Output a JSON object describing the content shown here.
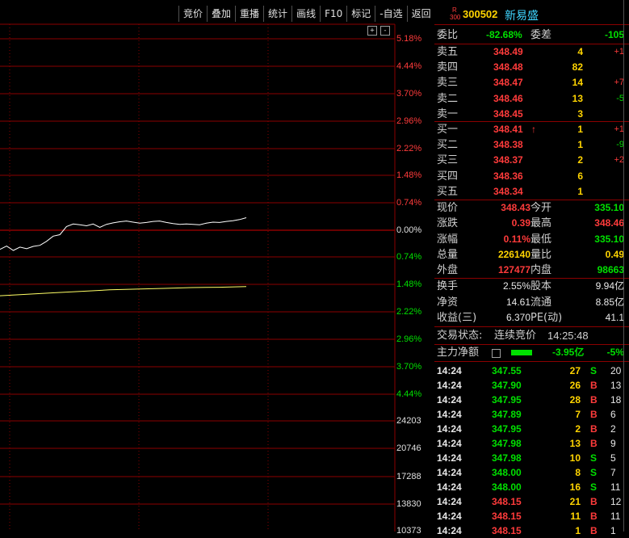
{
  "toolbar": [
    "竞价",
    "叠加",
    "重播",
    "统计",
    "画线",
    "F10",
    "标记",
    "-自选",
    "返回"
  ],
  "chart_controls": {
    "plus": "+",
    "minus": "-"
  },
  "price_axis": [
    "5.18%",
    "4.44%",
    "3.70%",
    "2.96%",
    "2.22%",
    "1.48%",
    "0.74%",
    "0.00%",
    "0.74%",
    "1.48%",
    "2.22%",
    "2.96%",
    "3.70%",
    "4.44%"
  ],
  "volume_axis": [
    "24203",
    "20746",
    "17288",
    "13830",
    "10373"
  ],
  "chart_data": {
    "type": "line",
    "series": [
      {
        "values": [
          -0.52,
          -0.43,
          -0.55,
          -0.46,
          -0.5,
          -0.44,
          -0.41,
          -0.3,
          -0.16,
          -0.12,
          0.1,
          0.17,
          0.15,
          0.12,
          0.17,
          0.08,
          0.16,
          0.2,
          0.23,
          0.25,
          0.22,
          0.19,
          0.21,
          0.24,
          0.25,
          0.21,
          0.18,
          0.16,
          0.17,
          0.16,
          0.15,
          0.19,
          0.22,
          0.21,
          0.24,
          0.26,
          0.29,
          0.34
        ]
      },
      {
        "values": [
          -1.78,
          -1.74,
          -1.7,
          -1.66,
          -1.62,
          -1.6,
          -1.58,
          -1.56,
          -1.55,
          -1.53
        ]
      }
    ]
  },
  "stock": {
    "badge_r": "R",
    "badge_300": "300",
    "code": "300502",
    "name": "新易盛"
  },
  "weibi": {
    "label": "委比",
    "value": "-82.68%",
    "label2": "委差",
    "value2": "-105"
  },
  "asks": [
    {
      "label": "卖五",
      "price": "348.49",
      "vol": "4",
      "chg": "+1"
    },
    {
      "label": "卖四",
      "price": "348.48",
      "vol": "82",
      "chg": ""
    },
    {
      "label": "卖三",
      "price": "348.47",
      "vol": "14",
      "chg": "+7"
    },
    {
      "label": "卖二",
      "price": "348.46",
      "vol": "13",
      "chg": "-5"
    },
    {
      "label": "卖一",
      "price": "348.45",
      "vol": "3",
      "chg": ""
    }
  ],
  "bids": [
    {
      "label": "买一",
      "price": "348.41",
      "arrow": "↑",
      "vol": "1",
      "chg": "+1"
    },
    {
      "label": "买二",
      "price": "348.38",
      "arrow": "",
      "vol": "1",
      "chg": "-9"
    },
    {
      "label": "买三",
      "price": "348.37",
      "arrow": "",
      "vol": "2",
      "chg": "+2"
    },
    {
      "label": "买四",
      "price": "348.36",
      "arrow": "",
      "vol": "6",
      "chg": ""
    },
    {
      "label": "买五",
      "price": "348.34",
      "arrow": "",
      "vol": "1",
      "chg": ""
    }
  ],
  "quote": [
    {
      "l1": "现价",
      "v1": "348.43",
      "l2": "今开",
      "v2": "335.10"
    },
    {
      "l1": "涨跌",
      "v1": "0.39",
      "l2": "最高",
      "v2": "348.46"
    },
    {
      "l1": "涨幅",
      "v1": "0.11%",
      "l2": "最低",
      "v2": "335.10"
    },
    {
      "l1": "总量",
      "v1": "226140",
      "l2": "量比",
      "v2": "0.49"
    },
    {
      "l1": "外盘",
      "v1": "127477",
      "l2": "内盘",
      "v2": "98663"
    }
  ],
  "fundamentals": [
    {
      "l1": "换手",
      "v1": "2.55%",
      "l2": "股本",
      "v2": "9.94亿"
    },
    {
      "l1": "净资",
      "v1": "14.61",
      "l2": "流通",
      "v2": "8.85亿"
    },
    {
      "l1": "收益(三)",
      "v1": "6.370",
      "l2": "PE(动)",
      "v2": "41.1"
    }
  ],
  "trade_status": {
    "label": "交易状态:",
    "value": "连续竞价",
    "time": "14:25:48"
  },
  "main_flow": {
    "label": "主力净额",
    "value": "-3.95亿",
    "pct": "-5%"
  },
  "ticks": [
    {
      "time": "14:24",
      "price": "347.55",
      "vol": "27",
      "side": "S",
      "num": "20"
    },
    {
      "time": "14:24",
      "price": "347.90",
      "vol": "26",
      "side": "B",
      "num": "13"
    },
    {
      "time": "14:24",
      "price": "347.95",
      "vol": "28",
      "side": "B",
      "num": "18"
    },
    {
      "time": "14:24",
      "price": "347.89",
      "vol": "7",
      "side": "B",
      "num": "6"
    },
    {
      "time": "14:24",
      "price": "347.95",
      "vol": "2",
      "side": "B",
      "num": "2"
    },
    {
      "time": "14:24",
      "price": "347.98",
      "vol": "13",
      "side": "B",
      "num": "9"
    },
    {
      "time": "14:24",
      "price": "347.98",
      "vol": "10",
      "side": "S",
      "num": "5"
    },
    {
      "time": "14:24",
      "price": "348.00",
      "vol": "8",
      "side": "S",
      "num": "7"
    },
    {
      "time": "14:24",
      "price": "348.00",
      "vol": "16",
      "side": "S",
      "num": "11"
    },
    {
      "time": "14:24",
      "price": "348.15",
      "vol": "21",
      "side": "B",
      "num": "12"
    },
    {
      "time": "14:24",
      "price": "348.15",
      "vol": "11",
      "side": "B",
      "num": "11"
    },
    {
      "time": "14:24",
      "price": "348.15",
      "vol": "1",
      "side": "B",
      "num": "1"
    }
  ],
  "colors": {
    "up": "#ff3b3b",
    "down": "#00e000",
    "grid": "#8b0000",
    "price_line": "#ffffff",
    "avg_line": "#ffff66",
    "accent": "#ffd400"
  }
}
